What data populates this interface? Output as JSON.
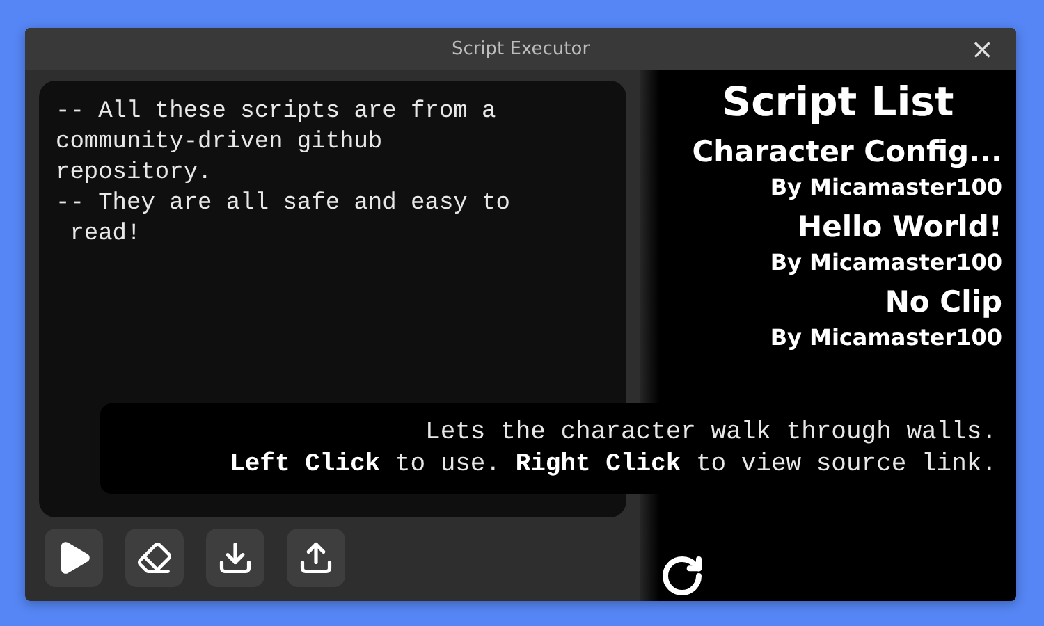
{
  "window": {
    "title": "Script Executor",
    "close": "×"
  },
  "editor": {
    "lines": [
      "-- All these scripts are from a",
      "community-driven github",
      "repository.",
      "-- They are all safe and easy to",
      " read!"
    ]
  },
  "toolbar": [
    {
      "kind": "play"
    },
    {
      "kind": "clear"
    },
    {
      "kind": "download"
    },
    {
      "kind": "upload"
    }
  ],
  "script_list": {
    "title": "Script List",
    "items": [
      {
        "name": "Character Config...",
        "author": "By Micamaster100"
      },
      {
        "name": "Hello World!",
        "author": "By Micamaster100"
      },
      {
        "name": "No Clip",
        "author": "By Micamaster100"
      }
    ]
  },
  "tooltip": {
    "lines": [
      "Lets the character walk through walls.",
      "**Left Click** to use. **Right Click** to view source link."
    ]
  }
}
